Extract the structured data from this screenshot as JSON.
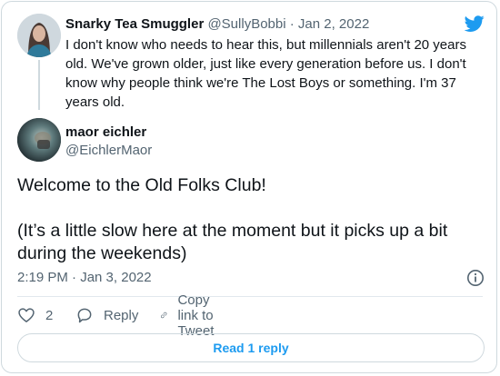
{
  "parent_tweet": {
    "display_name": "Snarky Tea Smuggler",
    "handle": "@SullyBobbi",
    "separator": "·",
    "date": "Jan 2, 2022",
    "text": "I don't know who needs to hear this, but millennials aren't 20 years old. We've grown older, just like every generation before us. I don't know why people think we're The Lost Boys or something. I'm 37 years old."
  },
  "main_tweet": {
    "display_name": "maor eichler",
    "handle": "@EichlerMaor",
    "paragraphs": [
      "Welcome to the Old Folks Club!",
      "(It’s a little slow here at the moment but it picks up a bit during the weekends)"
    ],
    "timestamp": "2:19 PM · Jan 3, 2022"
  },
  "actions": {
    "like_count": "2",
    "reply_label": "Reply",
    "copy_link_label": "Copy link to Tweet"
  },
  "footer": {
    "read_replies_label": "Read 1 reply"
  },
  "colors": {
    "twitter_blue": "#1d9bf0",
    "muted_text": "#536471",
    "border": "#cfd9de",
    "like_icon": "#536471"
  },
  "icons": [
    "twitter-bird-icon",
    "info-icon",
    "heart-icon",
    "reply-bubble-icon",
    "link-icon"
  ]
}
